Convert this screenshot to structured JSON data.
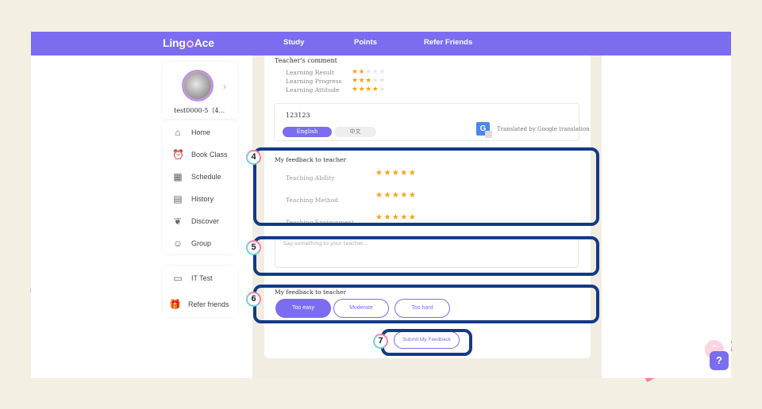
{
  "nav": {
    "logo": "LingoAce",
    "links": [
      "Study",
      "Points",
      "Refer Friends"
    ]
  },
  "profile": {
    "name": "test0000-5（4...",
    "chevron": "›"
  },
  "sidebar": {
    "items": [
      {
        "label": "Home",
        "icon": "home-icon"
      },
      {
        "label": "Book Class",
        "icon": "alarm-clock-icon"
      },
      {
        "label": "Schedule",
        "icon": "calendar-icon"
      },
      {
        "label": "History",
        "icon": "history-icon"
      },
      {
        "label": "Discover",
        "icon": "leaf-icon"
      },
      {
        "label": "Group",
        "icon": "group-icon"
      }
    ],
    "extra_items": [
      {
        "label": "IT Test",
        "icon": "monitor-icon"
      },
      {
        "label": "Refer friends",
        "icon": "gift-icon"
      }
    ]
  },
  "teacher_comment": {
    "title": "Teacher's comment",
    "ratings": [
      {
        "label": "Learning Result",
        "stars": 2,
        "max": 5
      },
      {
        "label": "Learning Progress",
        "stars": 3,
        "max": 5
      },
      {
        "label": "Learning Attitude",
        "stars": 4,
        "max": 5
      }
    ],
    "comment": "123123",
    "lang_english": "English",
    "lang_chinese": "中文",
    "translated_by": "Translated by Google translation"
  },
  "my_feedback": {
    "title": "My feedback to teacher",
    "ratings": [
      {
        "label": "Teaching Ability",
        "stars": 5
      },
      {
        "label": "Teaching Method",
        "stars": 5
      },
      {
        "label": "Teaching Environment",
        "stars": 5
      }
    ],
    "textarea_placeholder": "Say something to your teacher..."
  },
  "difficulty": {
    "title": "My feedback to teacher",
    "options": [
      "Too easy",
      "Moderate",
      "Too hard"
    ],
    "selected": "Too easy"
  },
  "submit_label": "Submit My Feedback",
  "annotations": [
    "4",
    "5",
    "6",
    "7"
  ],
  "help_label": "?",
  "colors": {
    "brand": "#7b6cf0",
    "star": "#f6a21b",
    "annotation": "#123a86",
    "background": "#f3efe3"
  }
}
